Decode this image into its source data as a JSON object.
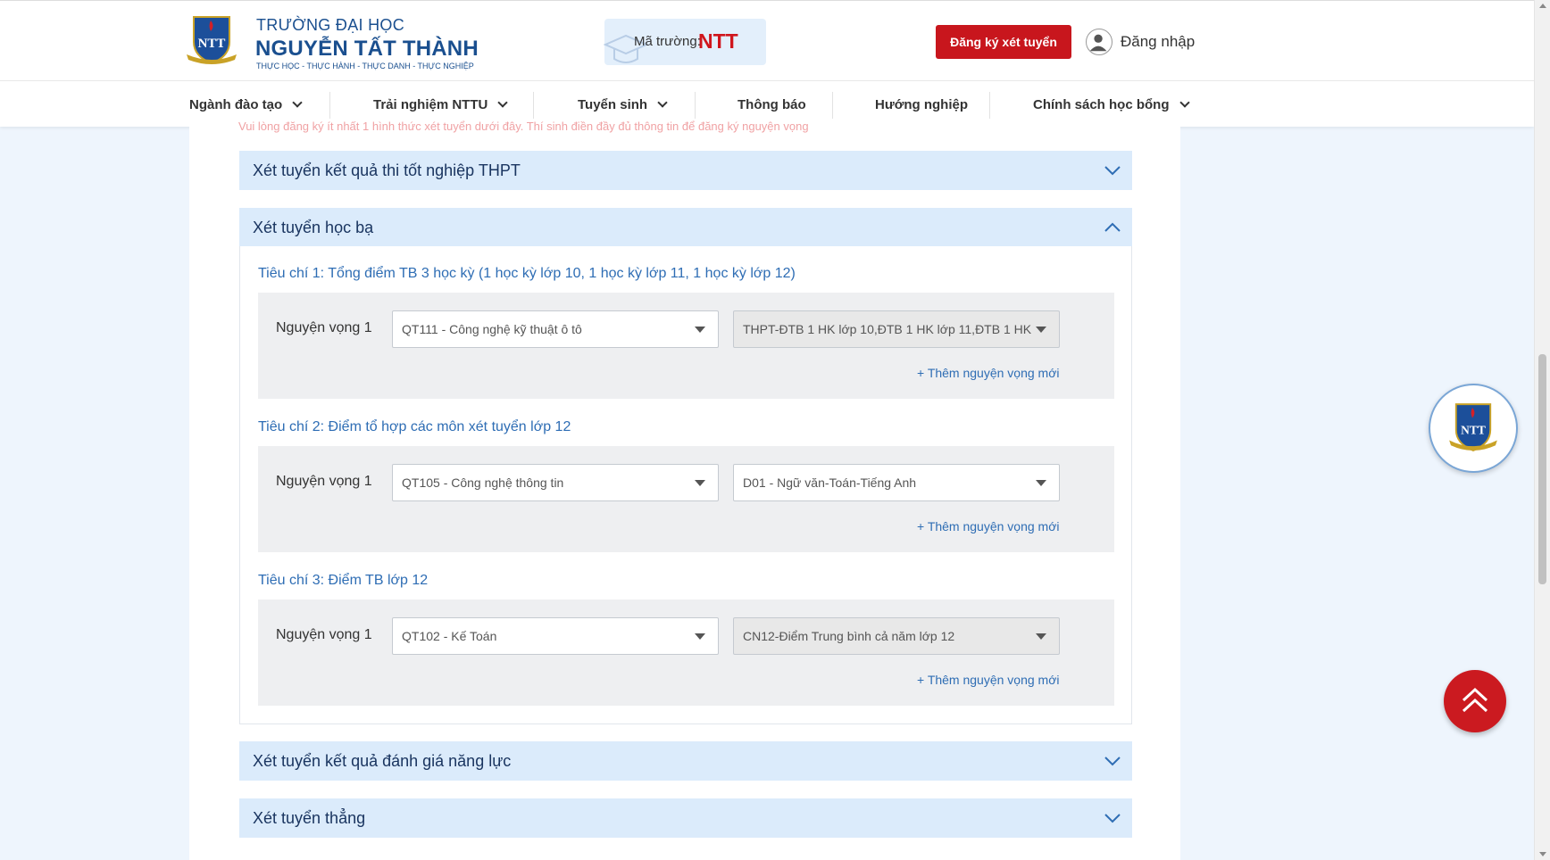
{
  "header": {
    "brand_line1": "TRƯỜNG ĐẠI HỌC",
    "brand_line2": "NGUYỄN TẤT THÀNH",
    "brand_line3": "THỰC HỌC - THỰC HÀNH - THỰC DANH - THỰC NGHIỆP",
    "logo_text": "NTT",
    "logo_caption": "NGUYEN TAT THANH",
    "school_code_label": "Mã trường:",
    "school_code_value": "NTT",
    "register_label": "Đăng ký xét tuyển",
    "login_label": "Đăng nhập"
  },
  "nav": {
    "items": [
      {
        "label": "Ngành đào tạo"
      },
      {
        "label": "Trải nghiệm NTTU"
      },
      {
        "label": "Tuyển sinh"
      },
      {
        "label": "Thông báo"
      },
      {
        "label": "Hướng nghiệp"
      },
      {
        "label": "Chính sách học bổng"
      }
    ]
  },
  "form": {
    "hint": "Vui lòng đăng ký ít nhất 1 hình thức xét tuyển dưới đây. Thí sinh điền đầy đủ thông tin để đăng ký nguyện vọng",
    "sections": [
      {
        "title": "Xét tuyển kết quả thi tốt nghiệp THPT"
      },
      {
        "title": "Xét tuyển học bạ"
      },
      {
        "title": "Xét tuyển kết quả đánh giá năng lực"
      },
      {
        "title": "Xét tuyển thẳng"
      }
    ],
    "criteria": [
      {
        "title": "Tiêu chí 1: Tổng điểm TB 3 học kỳ (1 học kỳ lớp 10, 1 học kỳ lớp 11, 1 học kỳ lớp 12)",
        "wish_label": "Nguyện vọng 1",
        "major": "QT111 - Công nghệ kỹ thuật ô tô",
        "combo": "THPT-ĐTB 1 HK lớp 10,ĐTB 1 HK lớp 11,ĐTB 1 HK",
        "add_label": "+ Thêm nguyện vọng mới"
      },
      {
        "title": "Tiêu chí 2: Điểm tổ hợp các môn xét tuyển lớp 12",
        "wish_label": "Nguyện vọng 1",
        "major": "QT105 - Công nghệ thông tin",
        "combo": "D01 - Ngữ văn-Toán-Tiếng Anh",
        "add_label": "+ Thêm nguyện vọng mới"
      },
      {
        "title": "Tiêu chí 3: Điểm TB lớp 12",
        "wish_label": "Nguyện vọng 1",
        "major": "QT102 - Kế Toán",
        "combo": "CN12-Điểm Trung bình cả năm lớp 12",
        "add_label": "+ Thêm nguyện vọng mới"
      }
    ]
  },
  "colors": {
    "primary_red": "#c8161d",
    "brand_blue": "#1a4f8f",
    "link_blue": "#2e6db4",
    "section_bg": "#dbebfb"
  }
}
